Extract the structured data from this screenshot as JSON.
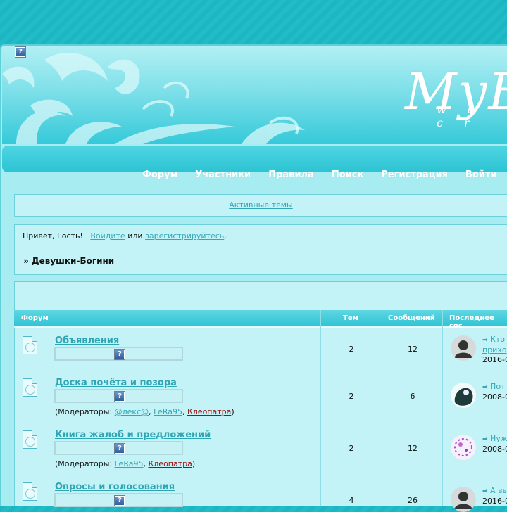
{
  "nav": {
    "items": [
      "Форум",
      "Участники",
      "Правила",
      "Поиск",
      "Регистрация",
      "Войти"
    ]
  },
  "header": {
    "logo_text": "MyB",
    "logo_sub": "we cr",
    "help_icon": "?"
  },
  "active_topics": {
    "label": "Активные темы"
  },
  "welcome": {
    "greeting": "Привет, Гость!",
    "login_link": "Войдите",
    "or": "или",
    "register_link": "зарегистрируйтесь",
    "period": "."
  },
  "breadcrumb": {
    "text": "» Девушки-Богини"
  },
  "table": {
    "headers": {
      "forum": "Форум",
      "topics": "Тем",
      "posts": "Сообщений",
      "last": "Последнее сос"
    },
    "rows": [
      {
        "title": "Объявления",
        "topics": "2",
        "posts": "12",
        "last_line1": "Кто",
        "last_line2": "прихо",
        "last_date": "2016-0",
        "moderators": null
      },
      {
        "title": "Доска почёта и позора",
        "topics": "2",
        "posts": "6",
        "last_line1": "Пот",
        "last_date": "2008-0",
        "mods_label": "(Модераторы: ",
        "mods": [
          "@лекс@",
          "LeRa95",
          "Клеопатра"
        ],
        "mods_end": ")"
      },
      {
        "title": "Книга жалоб и предложений",
        "topics": "2",
        "posts": "12",
        "last_line1": "Нуж",
        "last_date": "2008-0",
        "mods_label": "(Модераторы: ",
        "mods": [
          "LeRa95",
          "Клеопатра"
        ],
        "mods_end": ")"
      },
      {
        "title": "Опросы и голосования",
        "topics": "4",
        "posts": "26",
        "last_line1": "А вы",
        "last_date": "2016-0"
      }
    ]
  },
  "colors": {
    "accent": "#35a7b6",
    "moderator_red": "#9c1010",
    "bar": "#2ec4d4"
  }
}
